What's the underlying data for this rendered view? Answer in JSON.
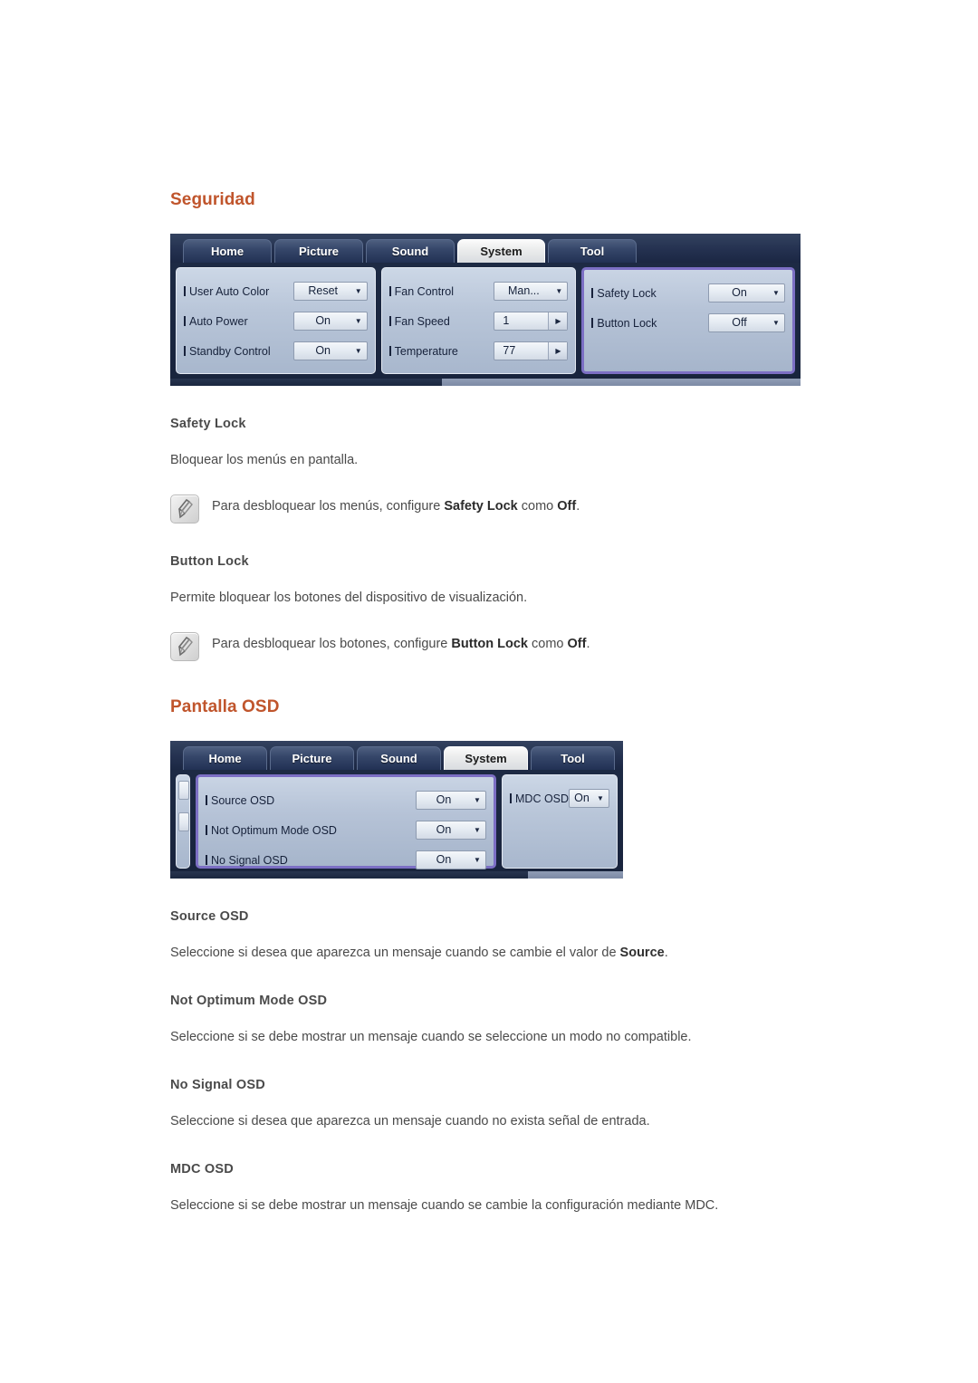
{
  "sections": [
    {
      "title": "Seguridad",
      "osd": {
        "tabs": [
          {
            "label": "Home",
            "active": false
          },
          {
            "label": "Picture",
            "active": false
          },
          {
            "label": "Sound",
            "active": false
          },
          {
            "label": "System",
            "active": true
          },
          {
            "label": "Tool",
            "active": false
          }
        ],
        "groups": [
          {
            "selected": false,
            "rows": [
              {
                "label": "User Auto Color",
                "value": "Reset",
                "control": "dropdown"
              },
              {
                "label": "Auto Power",
                "value": "On",
                "control": "dropdown"
              },
              {
                "label": "Standby Control",
                "value": "On",
                "control": "dropdown"
              }
            ]
          },
          {
            "selected": false,
            "rows": [
              {
                "label": "Fan Control",
                "value": "Man...",
                "control": "dropdown"
              },
              {
                "label": "Fan Speed",
                "value": "1",
                "control": "spinner"
              },
              {
                "label": "Temperature",
                "value": "77",
                "control": "spinner"
              }
            ]
          },
          {
            "selected": true,
            "rows": [
              {
                "label": "Safety Lock",
                "value": "On",
                "control": "dropdown"
              },
              {
                "label": "Button Lock",
                "value": "Off",
                "control": "dropdown"
              }
            ]
          }
        ]
      },
      "blocks": [
        {
          "heading": "Safety Lock",
          "paragraph": "Bloquear los menús en pantalla.",
          "note": {
            "pre": "Para desbloquear los menús, configure ",
            "bold1": "Safety Lock",
            "mid": " como ",
            "bold2": "Off",
            "post": "."
          }
        },
        {
          "heading": "Button Lock",
          "paragraph": "Permite bloquear los botones del dispositivo de visualización.",
          "note": {
            "pre": "Para desbloquear los botones, configure ",
            "bold1": "Button Lock",
            "mid": " como ",
            "bold2": "Off",
            "post": "."
          }
        }
      ]
    },
    {
      "title": "Pantalla OSD",
      "osd": {
        "tabs": [
          {
            "label": "Home",
            "active": false
          },
          {
            "label": "Picture",
            "active": false
          },
          {
            "label": "Sound",
            "active": false
          },
          {
            "label": "System",
            "active": true
          },
          {
            "label": "Tool",
            "active": false
          }
        ],
        "groups": [
          {
            "selected": true,
            "rows": [
              {
                "label": "Source OSD",
                "value": "On",
                "control": "dropdown"
              },
              {
                "label": "Not Optimum Mode OSD",
                "value": "On",
                "control": "dropdown"
              },
              {
                "label": "No Signal OSD",
                "value": "On",
                "control": "dropdown"
              }
            ]
          },
          {
            "selected": false,
            "rows": [
              {
                "label": "MDC OSD",
                "value": "On",
                "control": "dropdown"
              }
            ]
          }
        ]
      },
      "blocks": [
        {
          "heading": "Source OSD",
          "paragraph_pre": "Seleccione si desea que aparezca un mensaje cuando se cambie el valor de ",
          "paragraph_bold": "Source",
          "paragraph_post": "."
        },
        {
          "heading": "Not Optimum Mode OSD",
          "paragraph": "Seleccione si se debe mostrar un mensaje cuando se seleccione un modo no compatible."
        },
        {
          "heading": "No Signal OSD",
          "paragraph": "Seleccione si desea que aparezca un mensaje cuando no exista señal de entrada."
        },
        {
          "heading": "MDC OSD",
          "paragraph": "Seleccione si se debe mostrar un mensaje cuando se cambie la configuración mediante MDC."
        }
      ]
    }
  ],
  "icons": {
    "note": "note-pencil-icon",
    "caret": "▼",
    "spinner_arrow": "▶"
  },
  "colors": {
    "section_title": "#C0552C",
    "body_text": "#4a4a4a",
    "osd_selected_border": "#7c6fc4",
    "osd_chrome": "#1d2a44"
  }
}
